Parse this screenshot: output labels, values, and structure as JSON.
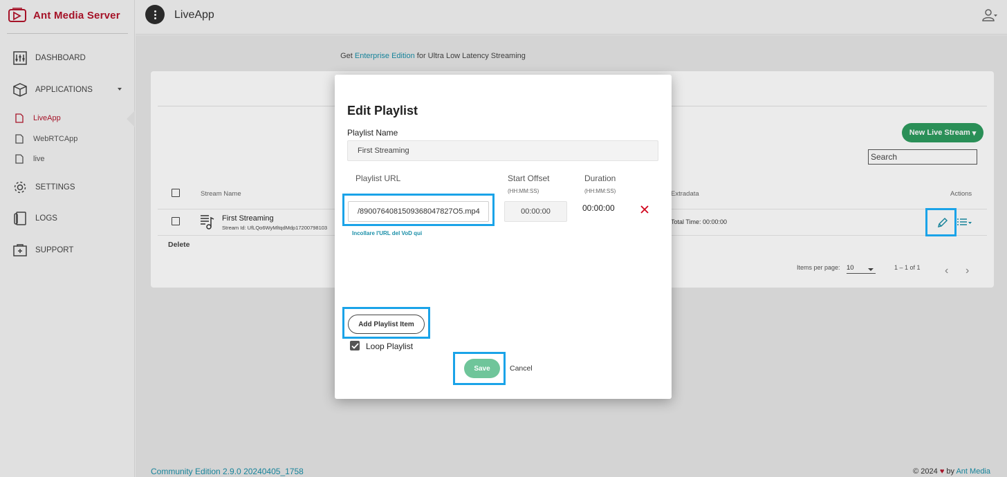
{
  "brand": {
    "name": "Ant Media Server"
  },
  "sidebar": {
    "items": [
      {
        "label": "DASHBOARD",
        "icon": "dashboard-icon"
      },
      {
        "label": "APPLICATIONS",
        "icon": "box-icon"
      },
      {
        "label": "SETTINGS",
        "icon": "gear-icon"
      },
      {
        "label": "LOGS",
        "icon": "logs-icon"
      },
      {
        "label": "SUPPORT",
        "icon": "support-icon"
      }
    ],
    "apps": [
      {
        "label": "LiveApp",
        "active": true
      },
      {
        "label": "WebRTCApp",
        "active": false
      },
      {
        "label": "live",
        "active": false
      }
    ]
  },
  "topbar": {
    "app_title": "LiveApp"
  },
  "promo": {
    "prefix": "Get ",
    "link": "Enterprise Edition",
    "suffix": " for Ultra Low Latency Streaming"
  },
  "table": {
    "new_stream_label": "New Live Stream",
    "search_value": "Search",
    "headers": {
      "stream_name": "Stream Name",
      "extradata": "Extradata",
      "actions": "Actions"
    },
    "rows": [
      {
        "name": "First Streaming",
        "stream_id": "Stream Id: UfLQo6WyMltqdMdp17200798103",
        "extradata": "Total Time: 00:00:00"
      }
    ],
    "delete_label": "Delete",
    "pagination": {
      "items_per_page_label": "Items per page:",
      "items_per_page": "10",
      "range": "1 – 1 of 1"
    }
  },
  "footer": {
    "edition": "Community Edition 2.9.0 20240405_1758",
    "copyright_prefix": "© 2024 ",
    "copyright_suffix": " by ",
    "company": "Ant Media"
  },
  "modal": {
    "title": "Edit Playlist",
    "name_label": "Playlist Name",
    "name_value": "First Streaming",
    "url_header": "Playlist URL",
    "offset_header": "Start Offset",
    "offset_sub": "(HH:MM:SS)",
    "duration_header": "Duration",
    "duration_sub": "(HH:MM:SS)",
    "items": [
      {
        "url": "/8900764081509368047827O5.mp4",
        "offset": "00:00:00",
        "duration": "00:00:00"
      }
    ],
    "url_hint": "Incollare l'URL del VoD qui",
    "add_label": "Add Playlist Item",
    "loop_label": "Loop Playlist",
    "loop_checked": true,
    "save_label": "Save",
    "cancel_label": "Cancel"
  },
  "colors": {
    "brand": "#b3142b",
    "accent": "#1a8fa8",
    "primary_green": "#2e9c5f",
    "highlight": "#1aa3e8"
  }
}
